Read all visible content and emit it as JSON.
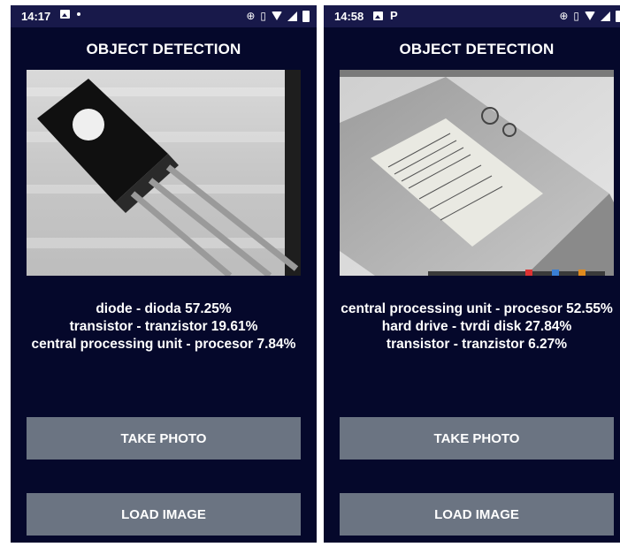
{
  "screens": [
    {
      "status": {
        "time": "14:17",
        "left_icons": [
          "image-icon",
          "dot-icon"
        ],
        "right_icons": [
          "data-saver-icon",
          "vibrate-icon",
          "wifi-icon",
          "signal-icon",
          "battery-icon"
        ]
      },
      "title": "OBJECT DETECTION",
      "image_description_icon": "transistor-photo",
      "results": [
        "diode - dioda 57.25%",
        "transistor - tranzistor 19.61%",
        "central processing unit - procesor 7.84%"
      ],
      "buttons": {
        "take_photo": "TAKE PHOTO",
        "load_image": "LOAD IMAGE"
      }
    },
    {
      "status": {
        "time": "14:58",
        "left_icons": [
          "image-icon",
          "p-icon"
        ],
        "right_icons": [
          "data-saver-icon",
          "vibrate-icon",
          "wifi-icon",
          "signal-icon",
          "battery-icon"
        ]
      },
      "title": "OBJECT DETECTION",
      "image_description_icon": "hard-drive-photo",
      "results": [
        "central processing unit - procesor 52.55%",
        "hard drive - tvrdi disk 27.84%",
        "transistor - tranzistor 6.27%"
      ],
      "buttons": {
        "take_photo": "TAKE PHOTO",
        "load_image": "LOAD IMAGE"
      }
    }
  ],
  "colors": {
    "background": "#05082b",
    "statusbar": "#18194a",
    "button": "#6b7482",
    "text": "#ffffff"
  }
}
